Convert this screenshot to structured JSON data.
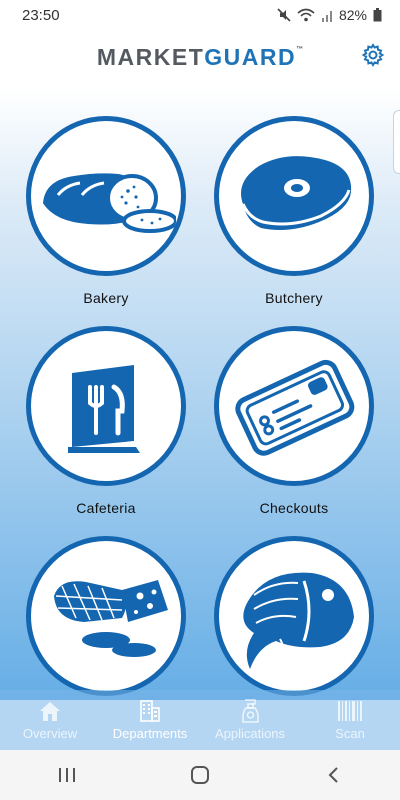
{
  "status_bar": {
    "time": "23:50",
    "battery": "82%"
  },
  "header": {
    "logo_market": "MARKET",
    "logo_guard": "GUARD",
    "logo_tm": "™"
  },
  "departments": [
    {
      "label": "Bakery",
      "icon": "bread-icon"
    },
    {
      "label": "Butchery",
      "icon": "steak-icon"
    },
    {
      "label": "Cafeteria",
      "icon": "menu-cutlery-icon"
    },
    {
      "label": "Checkouts",
      "icon": "credit-card-icon"
    },
    {
      "label": "",
      "icon": "deli-ham-cheese-icon"
    },
    {
      "label": "",
      "icon": "fish-icon"
    }
  ],
  "bottom_nav": [
    {
      "label": "Overview",
      "icon": "home-icon",
      "active": false
    },
    {
      "label": "Departments",
      "icon": "building-icon",
      "active": true
    },
    {
      "label": "Applications",
      "icon": "spray-bottle-icon",
      "active": false
    },
    {
      "label": "Scan",
      "icon": "barcode-icon",
      "active": false
    }
  ],
  "colors": {
    "brand_blue": "#1466b0",
    "logo_gray": "#555a60",
    "accent": "#1f73b7"
  }
}
